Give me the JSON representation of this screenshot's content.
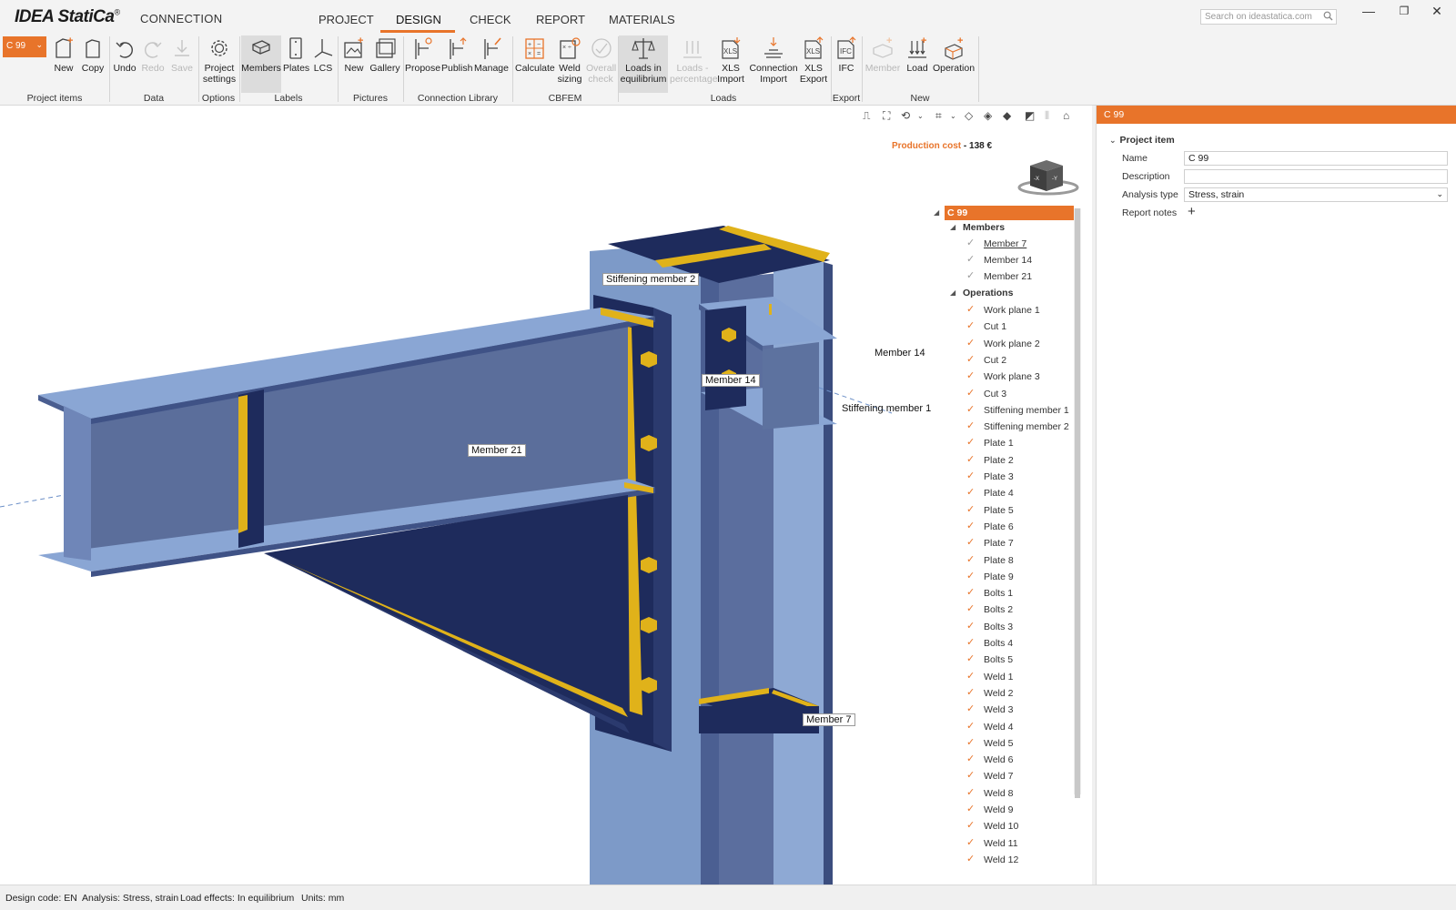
{
  "app": {
    "logo": "IDEA StatiCa",
    "logo_reg": "®",
    "product": "CONNECTION"
  },
  "main_tabs": [
    {
      "label": "PROJECT"
    },
    {
      "label": "DESIGN",
      "active": true
    },
    {
      "label": "CHECK"
    },
    {
      "label": "REPORT"
    },
    {
      "label": "MATERIALS"
    }
  ],
  "search": {
    "placeholder": "Search on ideastatica.com"
  },
  "window": {
    "minimize": "—",
    "restore": "❐",
    "close": "✕"
  },
  "ribbon": {
    "project_combo": "C 99",
    "buttons": {
      "new": "New",
      "copy": "Copy",
      "undo": "Undo",
      "redo": "Redo",
      "save": "Save",
      "project_settings_1": "Project",
      "project_settings_2": "settings",
      "members": "Members",
      "plates": "Plates",
      "lcs": "LCS",
      "pic_new": "New",
      "gallery": "Gallery",
      "propose": "Propose",
      "publish": "Publish",
      "manage": "Manage",
      "calculate": "Calculate",
      "weld_sizing_1": "Weld",
      "weld_sizing_2": "sizing",
      "overall_check_1": "Overall",
      "overall_check_2": "check",
      "loads_eq_1": "Loads in",
      "loads_eq_2": "equilibrium",
      "loads_pct_1": "Loads -",
      "loads_pct_2": "percentage",
      "xls_import_1": "XLS",
      "xls_import_2": "Import",
      "conn_import_1": "Connection",
      "conn_import_2": "Import",
      "xls_export_1": "XLS",
      "xls_export_2": "Export",
      "ifc": "IFC",
      "member": "Member",
      "load": "Load",
      "operation": "Operation"
    },
    "groups": {
      "project_items": "Project items",
      "data": "Data",
      "options": "Options",
      "labels": "Labels",
      "pictures": "Pictures",
      "connection_library": "Connection Library",
      "cbfem": "CBFEM",
      "loads": "Loads",
      "export": "Export",
      "new": "New"
    }
  },
  "viewport": {
    "production_cost_label": "Production cost",
    "production_cost_sep": "-",
    "production_cost_value": "138 €",
    "navcube_left": "-X",
    "navcube_right": "-Y",
    "labels": {
      "stiffening_member_2": "Stiffening member 2",
      "member_14_a": "Member 14",
      "member_14_b": "Member 14",
      "stiffening_member_1": "Stiffening member 1",
      "member_21": "Member 21",
      "member_7": "Member 7"
    }
  },
  "tree": {
    "root": "C 99",
    "members_label": "Members",
    "members": [
      "Member 7",
      "Member 14",
      "Member 21"
    ],
    "operations_label": "Operations",
    "operations": [
      "Work plane 1",
      "Cut 1",
      "Work plane 2",
      "Cut 2",
      "Work plane 3",
      "Cut 3",
      "Stiffening member 1",
      "Stiffening member 2",
      "Plate 1",
      "Plate 2",
      "Plate 3",
      "Plate 4",
      "Plate 5",
      "Plate 6",
      "Plate 7",
      "Plate 8",
      "Plate 9",
      "Bolts 1",
      "Bolts 2",
      "Bolts 3",
      "Bolts 4",
      "Bolts 5",
      "Weld 1",
      "Weld 2",
      "Weld 3",
      "Weld 4",
      "Weld 5",
      "Weld 6",
      "Weld 7",
      "Weld 8",
      "Weld 9",
      "Weld 10",
      "Weld 11",
      "Weld 12"
    ]
  },
  "properties": {
    "header": "C 99",
    "section": "Project item",
    "name_label": "Name",
    "name_value": "C 99",
    "description_label": "Description",
    "description_value": "",
    "analysis_label": "Analysis type",
    "analysis_value": "Stress, strain",
    "notes_label": "Report notes",
    "notes_add": "+"
  },
  "status": {
    "design_code": "Design code: EN",
    "analysis": "Analysis: Stress, strain",
    "load_effects": "Load effects: In equilibrium",
    "units": "Units: mm"
  },
  "colors": {
    "accent": "#e8742a",
    "steel_light": "#7f9ccc",
    "steel_dark": "#1f2d5c",
    "weld": "#e0b21a"
  }
}
